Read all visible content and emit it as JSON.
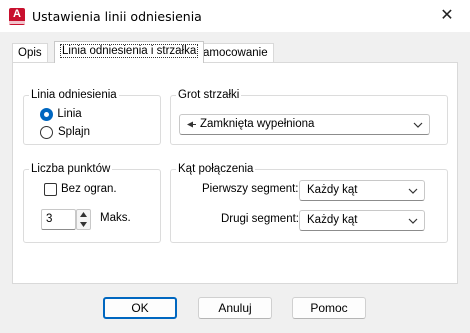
{
  "window": {
    "title": "Ustawienia linii odniesienia",
    "close_symbol": "✕"
  },
  "tabs": [
    {
      "label": "Opis",
      "active": false
    },
    {
      "label": "Linia odniesienia i strzałka",
      "active": true
    },
    {
      "label": "Zamocowanie",
      "active": false
    }
  ],
  "leader_line": {
    "title": "Linia odniesienia",
    "options": [
      {
        "label": "Linia",
        "checked": true
      },
      {
        "label": "Splajn",
        "checked": false
      }
    ]
  },
  "arrowhead": {
    "title": "Grot strzałki",
    "value": "Zamknięta wypełniona"
  },
  "points": {
    "title": "Liczba punktów",
    "no_limit_label": "Bez ogran.",
    "no_limit_checked": false,
    "count": "3",
    "max_label": "Maks."
  },
  "angle": {
    "title": "Kąt połączenia",
    "first_segment_label": "Pierwszy segment:",
    "first_segment_value": "Każdy kąt",
    "second_segment_label": "Drugi segment:",
    "second_segment_value": "Każdy kąt"
  },
  "buttons": {
    "ok": "OK",
    "cancel": "Anuluj",
    "help": "Pomoc"
  },
  "colors": {
    "accent": "#0067c0",
    "app_icon": "#c8102e"
  }
}
